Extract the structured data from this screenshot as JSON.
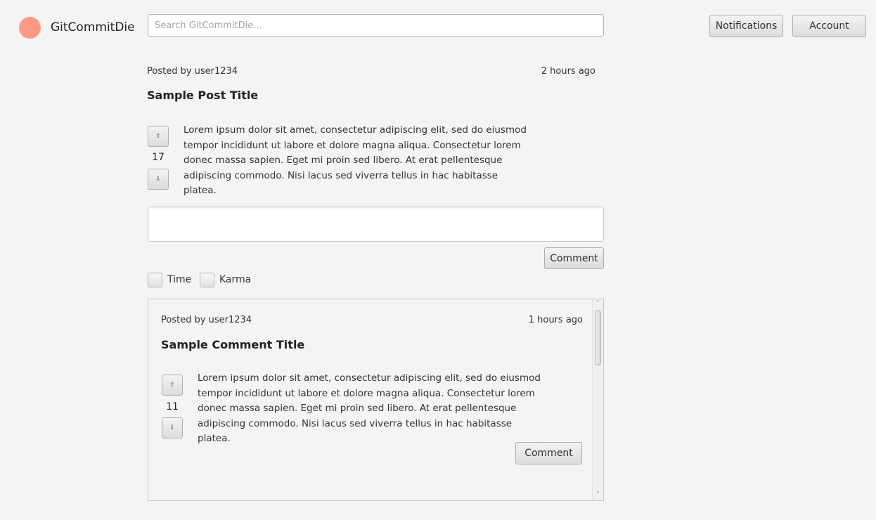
{
  "header": {
    "brand_color": "#ff9a85",
    "app_name": "GitCommitDie",
    "search_placeholder": "Search GitCommitDie...",
    "notifications_label": "Notifications",
    "account_label": "Account"
  },
  "post": {
    "author": "Posted by user1234",
    "time": "2 hours ago",
    "title": "Sample Post Title",
    "score": "17",
    "upvote_icon": "arrow-up-icon",
    "downvote_icon": "arrow-down-icon",
    "body": "Lorem ipsum dolor sit amet, consectetur adipiscing elit, sed do eiusmod tempor incididunt ut labore et dolore magna aliqua. Consectetur lorem donec massa sapien. Eget mi proin sed libero. At erat pellentesque adipiscing commodo. Nisi lacus sed viverra tellus in hac habitasse platea."
  },
  "comment_box": {
    "value": "",
    "submit_label": "Comment"
  },
  "sort": {
    "time_label": "Time",
    "time_checked": false,
    "karma_label": "Karma",
    "karma_checked": false
  },
  "comments": [
    {
      "author": "Posted by user1234",
      "time": "1 hours ago",
      "title": "Sample Comment Title",
      "score": "11",
      "body": "Lorem ipsum dolor sit amet, consectetur adipiscing elit, sed do eiusmod tempor incididunt ut labore et dolore magna aliqua. Consectetur lorem donec massa sapien. Eget mi proin sed libero. At erat pellentesque adipiscing commodo. Nisi lacus sed viverra tellus in hac habitasse platea.",
      "reply_label": "Comment"
    }
  ]
}
